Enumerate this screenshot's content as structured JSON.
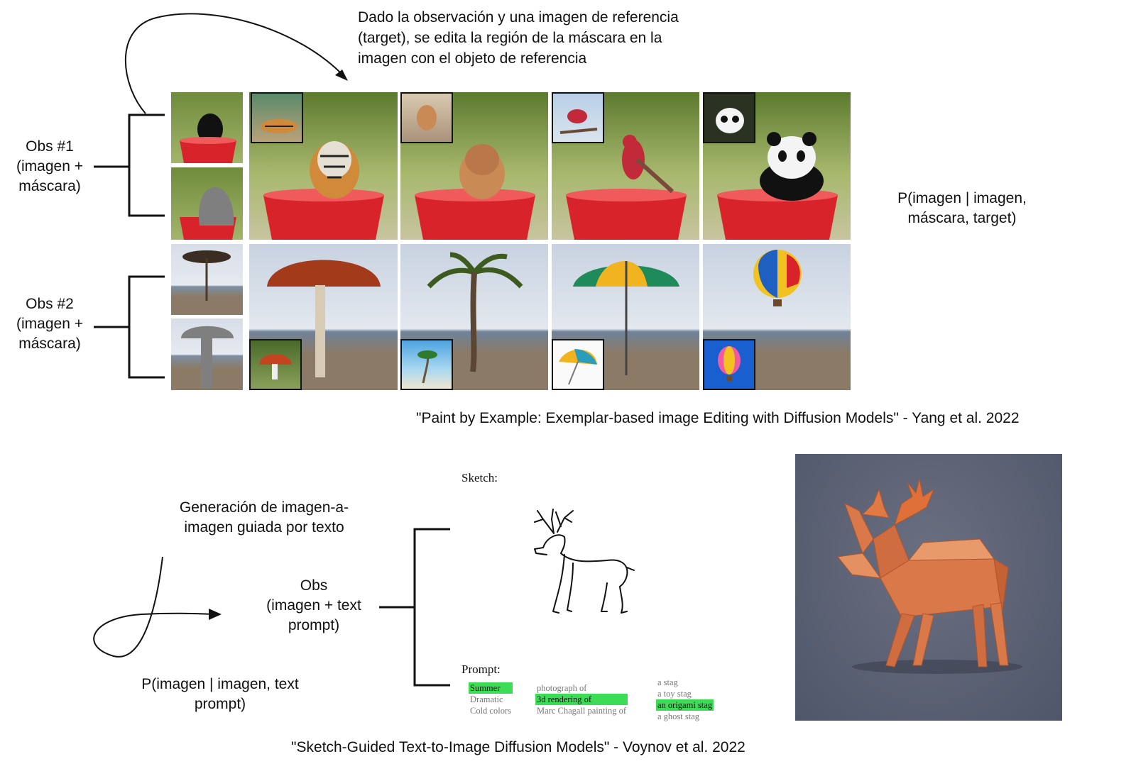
{
  "top": {
    "description": "Dado la observación y una imagen de referencia\n(target), se edita la región de la máscara en la\nimagen con el objeto de referencia",
    "obs1": "Obs #1\n(imagen +\nmáscara)",
    "obs2": "Obs #2\n(imagen +\nmáscara)",
    "probability": "P(imagen | imagen,\nmáscara, target)",
    "citation": "\"Paint by Example: Exemplar-based image Editing with Diffusion Models\" - Yang et al. 2022",
    "colors": {
      "bucket_red": "#d9232b",
      "mask_gray": "#7f7f7f",
      "sky": "#dde3ec",
      "sand": "#8b7a66",
      "foliage": "#6f8b3c"
    }
  },
  "bottom": {
    "generation_label": "Generación de imagen-a-\nimagen guiada por texto",
    "obs": "Obs\n(imagen + text\nprompt)",
    "probability": "P(imagen | imagen, text\nprompt)",
    "sketch_label": "Sketch:",
    "prompt_label": "Prompt:",
    "prompt_col1": [
      "Summer",
      "Dramatic",
      "Cold colors"
    ],
    "prompt_col2": [
      "photograph of",
      "3d rendering of",
      "Marc Chagall painting of"
    ],
    "prompt_col3": [
      "a stag",
      "a toy stag",
      "an origami stag",
      "a ghost stag"
    ],
    "citation": "\"Sketch-Guided Text-to-Image Diffusion Models\" - Voynov et al. 2022",
    "colors": {
      "highlight": "#3ddc57",
      "origami_bg": "#5a6070",
      "origami_stag": "#d9794a"
    }
  }
}
